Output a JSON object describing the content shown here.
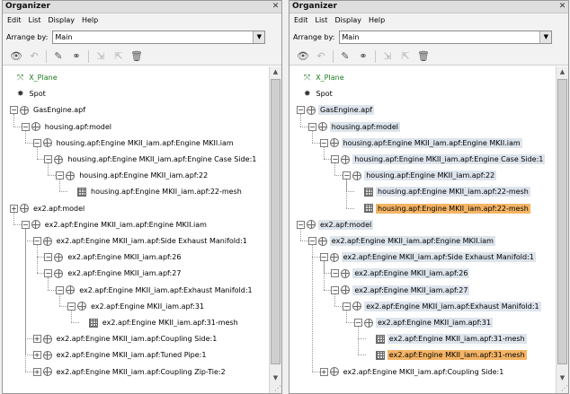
{
  "window": {
    "title": "Organizer",
    "close_glyph": "✕"
  },
  "menu": [
    "Edit",
    "List",
    "Display",
    "Help"
  ],
  "arrange": {
    "label": "Arrange by:",
    "value": "Main"
  },
  "toolbar_icons": [
    "eye-icon",
    "undo-icon",
    "wand-icon",
    "link-icon",
    "transfer-in-icon",
    "transfer-out-icon",
    "trash-icon"
  ],
  "left_tree": [
    {
      "depth": 0,
      "type": "special",
      "icon": "x-plane-icon",
      "label": "X_Plane",
      "green": true
    },
    {
      "depth": 0,
      "type": "special",
      "icon": "spot-icon",
      "label": "Spot"
    },
    {
      "depth": 0,
      "type": "node",
      "exp": "−",
      "label": "GasEngine.apf"
    },
    {
      "depth": 1,
      "type": "node",
      "exp": "−",
      "label": "housing.apf:model"
    },
    {
      "depth": 2,
      "type": "node",
      "exp": "−",
      "label": "housing.apf:Engine MKII_iam.apf:Engine MKII.iam"
    },
    {
      "depth": 3,
      "type": "node",
      "exp": "−",
      "label": "housing.apf:Engine MKII_iam.apf:Engine Case Side:1"
    },
    {
      "depth": 4,
      "type": "node",
      "exp": "−",
      "label": "housing.apf:Engine MKII_iam.apf:22"
    },
    {
      "depth": 5,
      "type": "leaf",
      "label": "housing.apf:Engine MKII_iam.apf:22-mesh"
    },
    {
      "depth": 0,
      "type": "node",
      "exp": "+",
      "label": "ex2.apf:model",
      "offset": 1
    },
    {
      "depth": 1,
      "type": "node",
      "exp": "−",
      "label": "ex2.apf:Engine MKII_iam.apf:Engine MKII.iam"
    },
    {
      "depth": 2,
      "type": "node",
      "exp": "−",
      "label": "ex2.apf:Engine MKII_iam.apf:Side Exhaust Manifold:1"
    },
    {
      "depth": 3,
      "type": "node",
      "exp": "−",
      "label": "ex2.apf:Engine MKII_iam.apf:26"
    },
    {
      "depth": 3,
      "type": "node",
      "exp": "−",
      "label": "ex2.apf:Engine MKII_iam.apf:27"
    },
    {
      "depth": 4,
      "type": "node",
      "exp": "−",
      "label": "ex2.apf:Engine MKII_iam.apf:Exhaust Manifold:1"
    },
    {
      "depth": 5,
      "type": "node",
      "exp": "−",
      "label": "ex2.apf:Engine MKII_iam.apf:31"
    },
    {
      "depth": 6,
      "type": "leaf",
      "label": "ex2.apf:Engine MKII_iam.apf:31-mesh"
    },
    {
      "depth": 2,
      "type": "node",
      "exp": "+",
      "label": "ex2.apf:Engine MKII_iam.apf:Coupling Side:1"
    },
    {
      "depth": 2,
      "type": "node",
      "exp": "+",
      "label": "ex2.apf:Engine MKII_iam.apf:Tuned Pipe:1"
    },
    {
      "depth": 2,
      "type": "node",
      "exp": "+",
      "label": "ex2.apf:Engine MKII_iam.apf:Coupling Zip-Tie:2"
    }
  ],
  "right_tree": [
    {
      "depth": 0,
      "type": "special",
      "icon": "x-plane-icon",
      "label": "X_Plane",
      "green": true
    },
    {
      "depth": 0,
      "type": "special",
      "icon": "spot-icon",
      "label": "Spot"
    },
    {
      "depth": 0,
      "type": "node",
      "exp": "−",
      "label": "GasEngine.apf",
      "hl": true
    },
    {
      "depth": 1,
      "type": "node",
      "exp": "−",
      "label": "housing.apf:model",
      "hl": true
    },
    {
      "depth": 2,
      "type": "node",
      "exp": "−",
      "label": "housing.apf:Engine MKII_iam.apf:Engine MKII.iam",
      "hl": true
    },
    {
      "depth": 3,
      "type": "node",
      "exp": "−",
      "label": "housing.apf:Engine MKII_iam.apf:Engine Case Side:1",
      "hl": true
    },
    {
      "depth": 4,
      "type": "node",
      "exp": "−",
      "label": "housing.apf:Engine MKII_iam.apf:22",
      "hl": true
    },
    {
      "depth": 5,
      "type": "leaf",
      "label": "housing.apf:Engine MKII_iam.apf:22-mesh",
      "hl": true
    },
    {
      "depth": 5,
      "type": "leaf",
      "label": "housing.apf:Engine MKII_iam.apf:22-mesh",
      "selected": true
    },
    {
      "depth": 0,
      "type": "node",
      "exp": "−",
      "label": "ex2.apf:model",
      "hl": true
    },
    {
      "depth": 1,
      "type": "node",
      "exp": "−",
      "label": "ex2.apf:Engine MKII_iam.apf:Engine MKII.iam",
      "hl": true
    },
    {
      "depth": 2,
      "type": "node",
      "exp": "−",
      "label": "ex2.apf:Engine MKII_iam.apf:Side Exhaust Manifold:1",
      "hl": true
    },
    {
      "depth": 3,
      "type": "node",
      "exp": "−",
      "label": "ex2.apf:Engine MKII_iam.apf:26",
      "hl": true
    },
    {
      "depth": 3,
      "type": "node",
      "exp": "−",
      "label": "ex2.apf:Engine MKII_iam.apf:27",
      "hl": true
    },
    {
      "depth": 4,
      "type": "node",
      "exp": "−",
      "label": "ex2.apf:Engine MKII_iam.apf:Exhaust Manifold:1",
      "hl": true
    },
    {
      "depth": 5,
      "type": "node",
      "exp": "−",
      "label": "ex2.apf:Engine MKII_iam.apf:31",
      "hl": true
    },
    {
      "depth": 6,
      "type": "leaf",
      "label": "ex2.apf:Engine MKII_iam.apf:31-mesh",
      "hl": true
    },
    {
      "depth": 6,
      "type": "leaf",
      "label": "ex2.apf:Engine MKII_iam.apf:31-mesh",
      "selected": true
    },
    {
      "depth": 2,
      "type": "node",
      "exp": "+",
      "label": "ex2.apf:Engine MKII_iam.apf:Coupling Side:1"
    }
  ]
}
